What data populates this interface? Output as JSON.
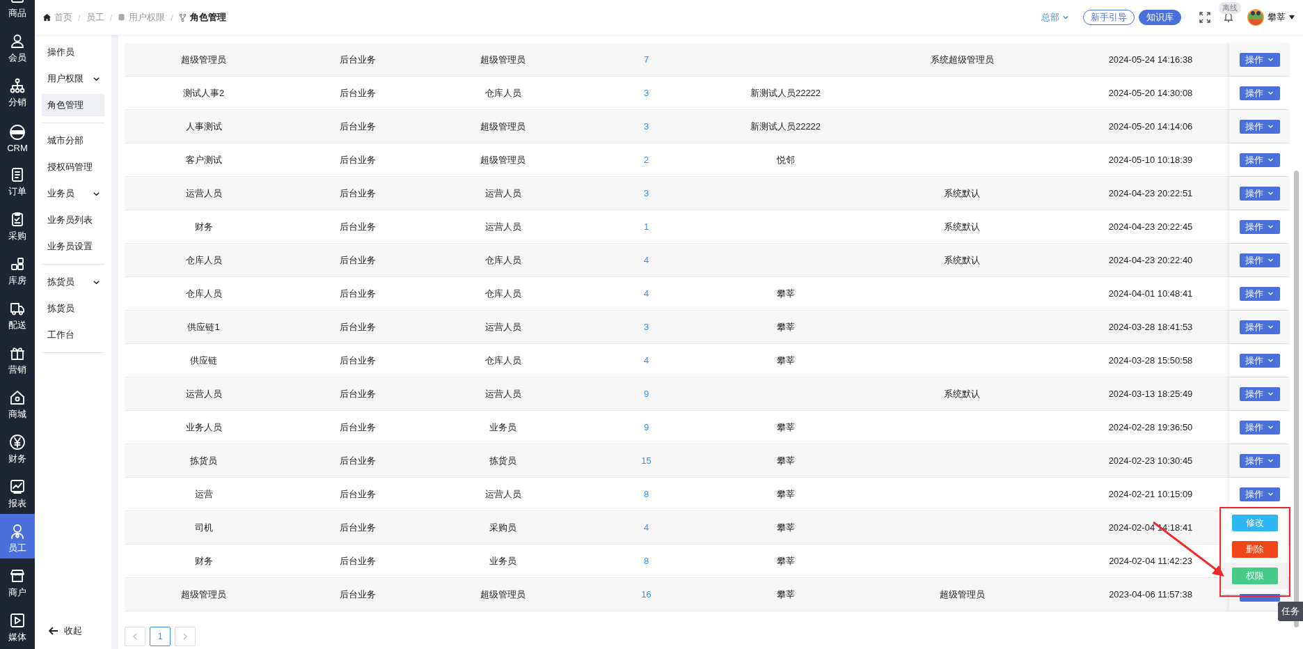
{
  "rail": [
    {
      "label": "商品",
      "selected": false
    },
    {
      "label": "会员",
      "selected": false
    },
    {
      "label": "分销",
      "selected": false
    },
    {
      "label": "CRM",
      "selected": false
    },
    {
      "label": "订单",
      "selected": false
    },
    {
      "label": "采购",
      "selected": false
    },
    {
      "label": "库房",
      "selected": false
    },
    {
      "label": "配送",
      "selected": false
    },
    {
      "label": "营销",
      "selected": false
    },
    {
      "label": "商城",
      "selected": false
    },
    {
      "label": "财务",
      "selected": false
    },
    {
      "label": "报表",
      "selected": false
    },
    {
      "label": "员工",
      "selected": true
    },
    {
      "label": "商户",
      "selected": false
    },
    {
      "label": "媒体",
      "selected": false
    }
  ],
  "breadcrumb": {
    "separator": "/",
    "items": [
      {
        "label": "首页"
      },
      {
        "label": "员工"
      },
      {
        "label": "用户权限"
      },
      {
        "label": "角色管理"
      }
    ]
  },
  "header": {
    "org": "总部",
    "guide_button": "新手引导",
    "kb_button": "知识库",
    "status_badge": "离线",
    "user": "攀莘"
  },
  "submenu": [
    {
      "kind": "item",
      "label": "操作员",
      "selected": false
    },
    {
      "kind": "group",
      "label": "用户权限",
      "expanded": true,
      "children": [
        {
          "label": "角色管理",
          "selected": true
        }
      ]
    },
    {
      "kind": "item",
      "label": "城市分部",
      "selected": false
    },
    {
      "kind": "item",
      "label": "授权码管理",
      "selected": false
    },
    {
      "kind": "group",
      "label": "业务员",
      "expanded": true,
      "children": [
        {
          "label": "业务员列表",
          "selected": false
        },
        {
          "label": "业务员设置",
          "selected": false
        }
      ]
    },
    {
      "kind": "group",
      "label": "拣货员",
      "expanded": true,
      "children": [
        {
          "label": "拣货员",
          "selected": false
        },
        {
          "label": "工作台",
          "selected": false
        }
      ]
    }
  ],
  "collapse_button": "收起",
  "table": {
    "rows": [
      {
        "column_1": "超级管理员",
        "column_2": "后台业务",
        "column_3": "超级管理员",
        "column_4": "7",
        "column_6": "系统超级管理员",
        "column_7": "2024-05-24 14:16:38",
        "action": "操作"
      },
      {
        "column_1": "测试人事2",
        "column_2": "后台业务",
        "column_3": "仓库人员",
        "column_4": "3",
        "column_5": "新测试人员22222",
        "column_7": "2024-05-20 14:30:08",
        "action": "操作"
      },
      {
        "column_1": "人事测试",
        "column_2": "后台业务",
        "column_3": "超级管理员",
        "column_4": "3",
        "column_5": "新测试人员22222",
        "column_7": "2024-05-20 14:14:06",
        "action": "操作"
      },
      {
        "column_1": "客户测试",
        "column_2": "后台业务",
        "column_3": "超级管理员",
        "column_4": "2",
        "column_5": "悦邻",
        "column_7": "2024-05-10 10:18:39",
        "action": "操作"
      },
      {
        "column_1": "运营人员",
        "column_2": "后台业务",
        "column_3": "运营人员",
        "column_4": "3",
        "column_6": "系统默认",
        "column_7": "2024-04-23 20:22:51",
        "action": "操作"
      },
      {
        "column_1": "财务",
        "column_2": "后台业务",
        "column_3": "运营人员",
        "column_4": "1",
        "column_6": "系统默认",
        "column_7": "2024-04-23 20:22:45",
        "action": "操作"
      },
      {
        "column_1": "仓库人员",
        "column_2": "后台业务",
        "column_3": "仓库人员",
        "column_4": "4",
        "column_6": "系统默认",
        "column_7": "2024-04-23 20:22:40",
        "action": "操作"
      },
      {
        "column_1": "仓库人员",
        "column_2": "后台业务",
        "column_3": "仓库人员",
        "column_4": "4",
        "column_5": "攀莘",
        "column_7": "2024-04-01 10:48:41",
        "action": "操作"
      },
      {
        "column_1": "供应链1",
        "column_2": "后台业务",
        "column_3": "运营人员",
        "column_4": "3",
        "column_5": "攀莘",
        "column_7": "2024-03-28 18:41:53",
        "action": "操作"
      },
      {
        "column_1": "供应链",
        "column_2": "后台业务",
        "column_3": "仓库人员",
        "column_4": "4",
        "column_5": "攀莘",
        "column_7": "2024-03-28 15:50:58",
        "action": "操作"
      },
      {
        "column_1": "运营人员",
        "column_2": "后台业务",
        "column_3": "运营人员",
        "column_4": "9",
        "column_6": "系统默认",
        "column_7": "2024-03-13 18:25:49",
        "action": "操作"
      },
      {
        "column_1": "业务人员",
        "column_2": "后台业务",
        "column_3": "业务员",
        "column_4": "9",
        "column_5": "攀莘",
        "column_7": "2024-02-28 19:36:50",
        "action": "操作"
      },
      {
        "column_1": "拣货员",
        "column_2": "后台业务",
        "column_3": "拣货员",
        "column_4": "15",
        "column_5": "攀莘",
        "column_7": "2024-02-23 10:30:45",
        "action": "操作"
      },
      {
        "column_1": "运营",
        "column_2": "后台业务",
        "column_3": "运营人员",
        "column_4": "8",
        "column_5": "攀莘",
        "column_7": "2024-02-21 10:15:09",
        "action": "操作"
      },
      {
        "column_1": "司机",
        "column_2": "后台业务",
        "column_3": "采购员",
        "column_4": "4",
        "column_5": "攀莘",
        "column_7": "2024-02-04 14:18:41"
      },
      {
        "column_1": "财务",
        "column_2": "后台业务",
        "column_3": "业务员",
        "column_4": "8",
        "column_5": "攀莘",
        "column_7": "2024-02-04 11:42:23"
      },
      {
        "column_1": "超级管理员",
        "column_2": "后台业务",
        "column_3": "超级管理员",
        "column_4": "16",
        "column_5": "攀莘",
        "column_6": "超级管理员",
        "column_7": "2023-04-06 11:57:38"
      }
    ]
  },
  "action_menu": [
    {
      "label": "修改",
      "color": "#2db7f5"
    },
    {
      "label": "删除",
      "color": "#f0461a"
    },
    {
      "label": "权限",
      "color": "#47cb89"
    }
  ],
  "pagination": {
    "pages": [
      {
        "label": "1",
        "selected": true
      }
    ]
  },
  "tooltip": "任务"
}
